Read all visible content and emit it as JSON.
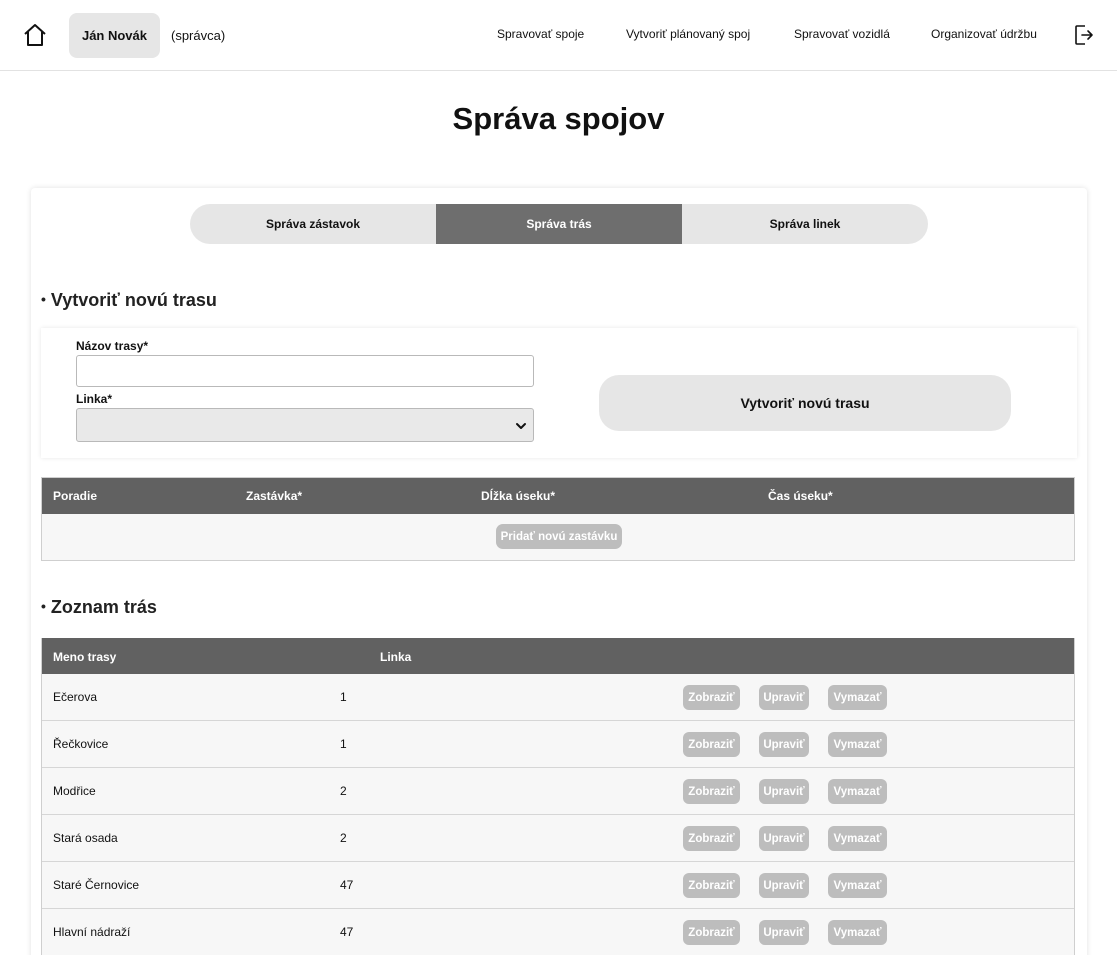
{
  "header": {
    "home_icon": "home-icon",
    "user_name": "Ján Novák",
    "user_role": "(správca)",
    "nav": [
      "Spravovať spoje",
      "Vytvoriť plánovaný spoj",
      "Spravovať vozidlá",
      "Organizovať údržbu"
    ],
    "logout_icon": "logout-icon"
  },
  "page_title": "Správa spojov",
  "tabs": {
    "items": [
      "Správa zástavok",
      "Správa trás",
      "Správa linek"
    ],
    "active": "Správa trás"
  },
  "create_section": {
    "bullet": "•",
    "title": "Vytvoriť novú trasu",
    "name_label": "Názov trasy*",
    "name_value": "",
    "line_label": "Linka*",
    "line_value": "",
    "submit_label": "Vytvoriť novú trasu"
  },
  "stops_table": {
    "columns": [
      "Poradie",
      "Zastávka*",
      "Dĺžka úseku*",
      "Čas úseku*"
    ],
    "add_button": "Pridať novú zastávku"
  },
  "routes_section": {
    "bullet": "•",
    "title": "Zoznam trás",
    "columns": [
      "Meno trasy",
      "Linka"
    ],
    "actions": [
      "Zobraziť",
      "Upraviť",
      "Vymazať"
    ],
    "rows": [
      {
        "name": "Ečerova",
        "line": "1"
      },
      {
        "name": "Řečkovice",
        "line": "1"
      },
      {
        "name": "Modřice",
        "line": "2"
      },
      {
        "name": "Stará osada",
        "line": "2"
      },
      {
        "name": "Staré Černovice",
        "line": "47"
      },
      {
        "name": "Hlavní nádraží",
        "line": "47"
      }
    ]
  },
  "colors": {
    "header_row": "#616161",
    "active_tab": "#6e6e6e",
    "chip": "#e6e6e6",
    "disabled_button": "#bdbdbd"
  }
}
